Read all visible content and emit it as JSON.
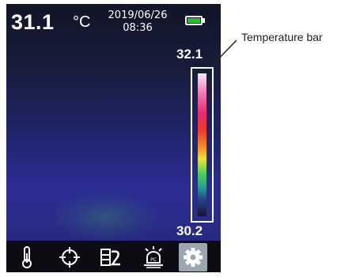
{
  "status": {
    "temperature": "31.1",
    "unit": "°C",
    "date": "2019/06/26",
    "time": "08:36",
    "battery_color": "#22c02a"
  },
  "temperature_bar": {
    "max": "32.1",
    "min": "30.2"
  },
  "toolbar": {
    "items": [
      {
        "icon": "thermometer-icon"
      },
      {
        "icon": "crosshair-icon"
      },
      {
        "icon": "palette-icon"
      },
      {
        "icon": "pc-alarm-icon"
      },
      {
        "icon": "gear-icon",
        "active": true
      }
    ]
  },
  "annotation": {
    "label": "Temperature bar"
  }
}
